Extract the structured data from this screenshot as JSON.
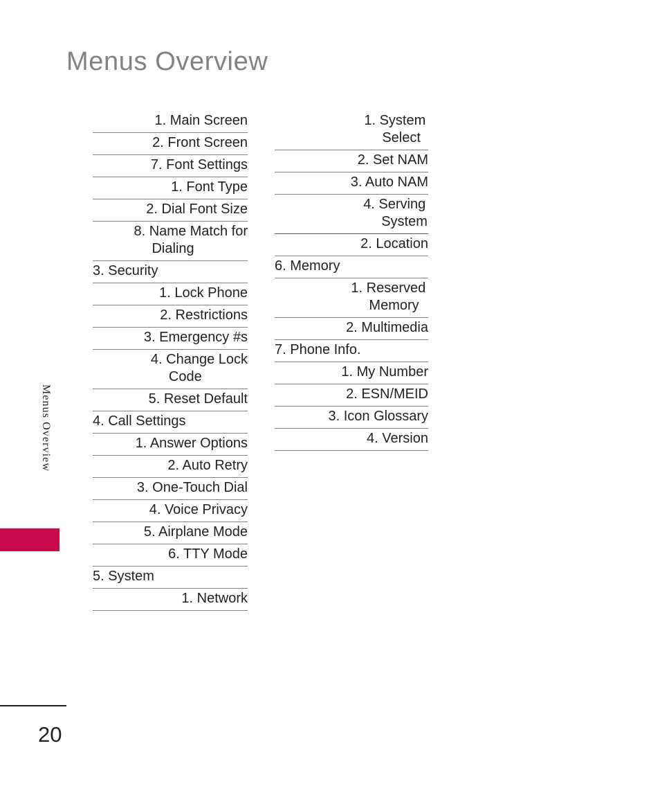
{
  "document": {
    "title": "Menus Overview",
    "page_number": "20",
    "side_tab_label": "Menus Overview",
    "accent_color": "#c60a4b",
    "title_color": "#808285",
    "text_color": "#231f20",
    "rule_color": "#808285"
  },
  "columns": [
    {
      "name": "left-column",
      "rows": [
        {
          "label": "1. Main Screen",
          "level": 3,
          "wrap": false,
          "thick": false
        },
        {
          "label": "2. Front Screen",
          "level": 3,
          "wrap": false,
          "thick": false
        },
        {
          "label": "7. Font Settings",
          "level": 2,
          "wrap": false,
          "thick": false
        },
        {
          "label": "1. Font Type",
          "level": 3,
          "wrap": false,
          "thick": false
        },
        {
          "label": "2. Dial Font Size",
          "level": 3,
          "wrap": false,
          "thick": false
        },
        {
          "label": "8. Name Match for\nDialing",
          "level": 2,
          "wrap": true,
          "thick": false
        },
        {
          "label": "3. Security",
          "level": 1,
          "wrap": false,
          "thick": false
        },
        {
          "label": "1. Lock Phone",
          "level": 2,
          "wrap": false,
          "thick": false
        },
        {
          "label": "2. Restrictions",
          "level": 2,
          "wrap": false,
          "thick": false
        },
        {
          "label": "3. Emergency #s",
          "level": 2,
          "wrap": false,
          "thick": false
        },
        {
          "label": "4. Change Lock\nCode",
          "level": 2,
          "wrap": true,
          "thick": false
        },
        {
          "label": "5. Reset Default",
          "level": 2,
          "wrap": false,
          "thick": false
        },
        {
          "label": "4. Call Settings",
          "level": 1,
          "wrap": false,
          "thick": false
        },
        {
          "label": "1. Answer Options",
          "level": 2,
          "wrap": false,
          "thick": false
        },
        {
          "label": "2. Auto Retry",
          "level": 2,
          "wrap": false,
          "thick": false
        },
        {
          "label": "3. One-Touch Dial",
          "level": 2,
          "wrap": false,
          "thick": false
        },
        {
          "label": "4. Voice Privacy",
          "level": 2,
          "wrap": false,
          "thick": false
        },
        {
          "label": "5. Airplane Mode",
          "level": 2,
          "wrap": false,
          "thick": false
        },
        {
          "label": "6. TTY Mode",
          "level": 2,
          "wrap": false,
          "thick": false
        },
        {
          "label": "5. System",
          "level": 1,
          "wrap": false,
          "thick": false
        },
        {
          "label": "1. Network",
          "level": 2,
          "wrap": false,
          "thick": false
        }
      ]
    },
    {
      "name": "right-column",
      "rows": [
        {
          "label": "1. System\nSelect",
          "level": 3,
          "wrap": true,
          "thick": false
        },
        {
          "label": "2. Set NAM",
          "level": 3,
          "wrap": false,
          "thick": false
        },
        {
          "label": "3. Auto NAM",
          "level": 3,
          "wrap": false,
          "thick": false
        },
        {
          "label": "4. Serving\nSystem",
          "level": 3,
          "wrap": true,
          "thick": true
        },
        {
          "label": "2. Location",
          "level": 2,
          "wrap": false,
          "thick": false
        },
        {
          "label": "6. Memory",
          "level": 1,
          "wrap": false,
          "thick": false
        },
        {
          "label": "1. Reserved\nMemory",
          "level": 2,
          "wrap": true,
          "thick": false
        },
        {
          "label": "2. Multimedia",
          "level": 2,
          "wrap": false,
          "thick": false
        },
        {
          "label": "7. Phone Info.",
          "level": 1,
          "wrap": false,
          "thick": false
        },
        {
          "label": "1. My Number",
          "level": 2,
          "wrap": false,
          "thick": false
        },
        {
          "label": "2. ESN/MEID",
          "level": 2,
          "wrap": false,
          "thick": false
        },
        {
          "label": "3. Icon Glossary",
          "level": 2,
          "wrap": false,
          "thick": false
        },
        {
          "label": "4. Version",
          "level": 2,
          "wrap": false,
          "thick": false
        }
      ]
    }
  ]
}
